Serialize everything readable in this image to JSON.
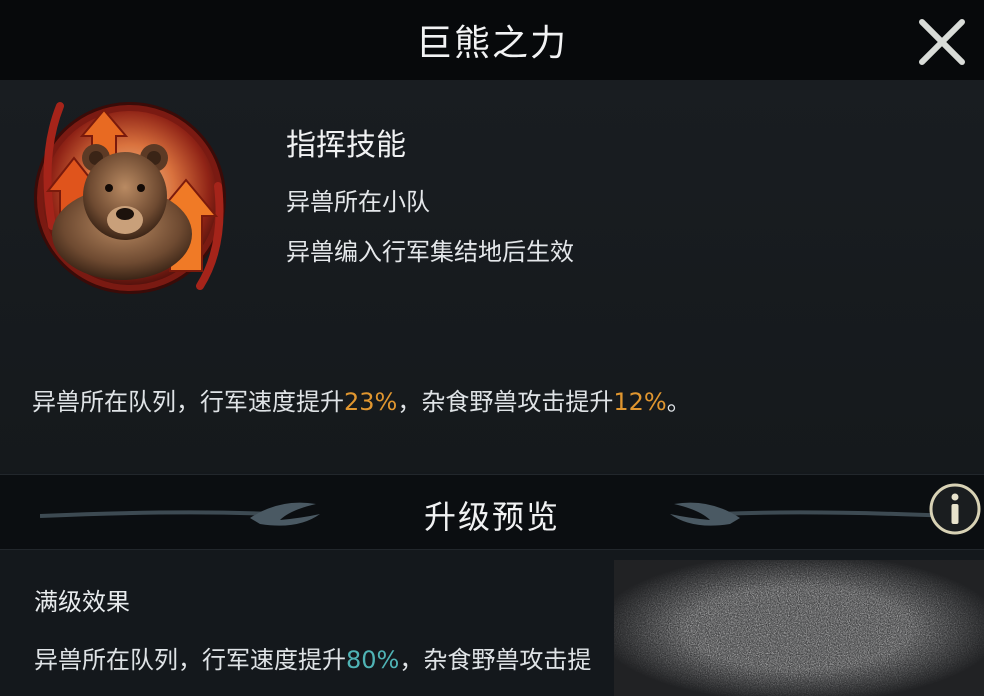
{
  "header": {
    "title": "巨熊之力"
  },
  "skill": {
    "icon": "bear-skill-icon",
    "type": "指挥技能",
    "scope": "异兽所在小队",
    "condition": "异兽编入行军集结地后生效",
    "effect": {
      "prefix": "异兽所在队列，行军速度提升",
      "speed": "23%",
      "middle": "，杂食野兽攻击提升",
      "attack": "12%",
      "suffix": "。"
    }
  },
  "upgrade": {
    "title": "升级预览",
    "max_label": "满级效果",
    "max_effect": {
      "prefix": "异兽所在队列，行军速度提升",
      "speed": "80%",
      "middle": "，杂食野兽攻击提"
    }
  },
  "colors": {
    "highlight_current": "#e0962f",
    "highlight_max": "#4fb3b5",
    "background": "#14181c"
  }
}
